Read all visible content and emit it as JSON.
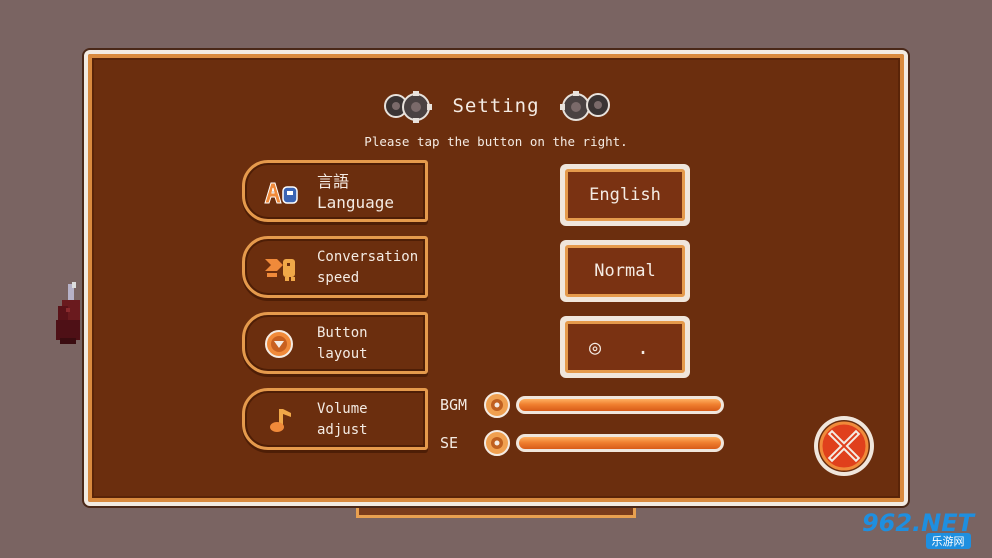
{
  "dialog": {
    "title": "Setting",
    "subtitle": "Please tap the button on the right."
  },
  "rows": [
    {
      "icon": "language-icon",
      "label_lines": [
        "言語",
        "Language"
      ],
      "value": "English"
    },
    {
      "icon": "speech-speed-icon",
      "label_lines": [
        "Conversation",
        "speed"
      ],
      "value": "Normal"
    },
    {
      "icon": "button-layout-icon",
      "label_lines": [
        "Button",
        "layout"
      ],
      "value": "◎ ."
    },
    {
      "icon": "music-note-icon",
      "label_lines": [
        "Volume",
        "adjust"
      ]
    }
  ],
  "volume": {
    "bgm": {
      "label": "BGM",
      "level": 1.0
    },
    "se": {
      "label": "SE",
      "level": 1.0
    }
  },
  "close": {
    "icon": "close-x-icon"
  },
  "watermark": {
    "brand": "962.NET",
    "sub": "乐游网"
  },
  "colors": {
    "panel": "#6b2e0e",
    "border_orange": "#e59a4c",
    "border_light": "#f0e6dc",
    "text": "#f4ebe3",
    "accent_red": "#e0401c",
    "background": "#7a6462"
  }
}
